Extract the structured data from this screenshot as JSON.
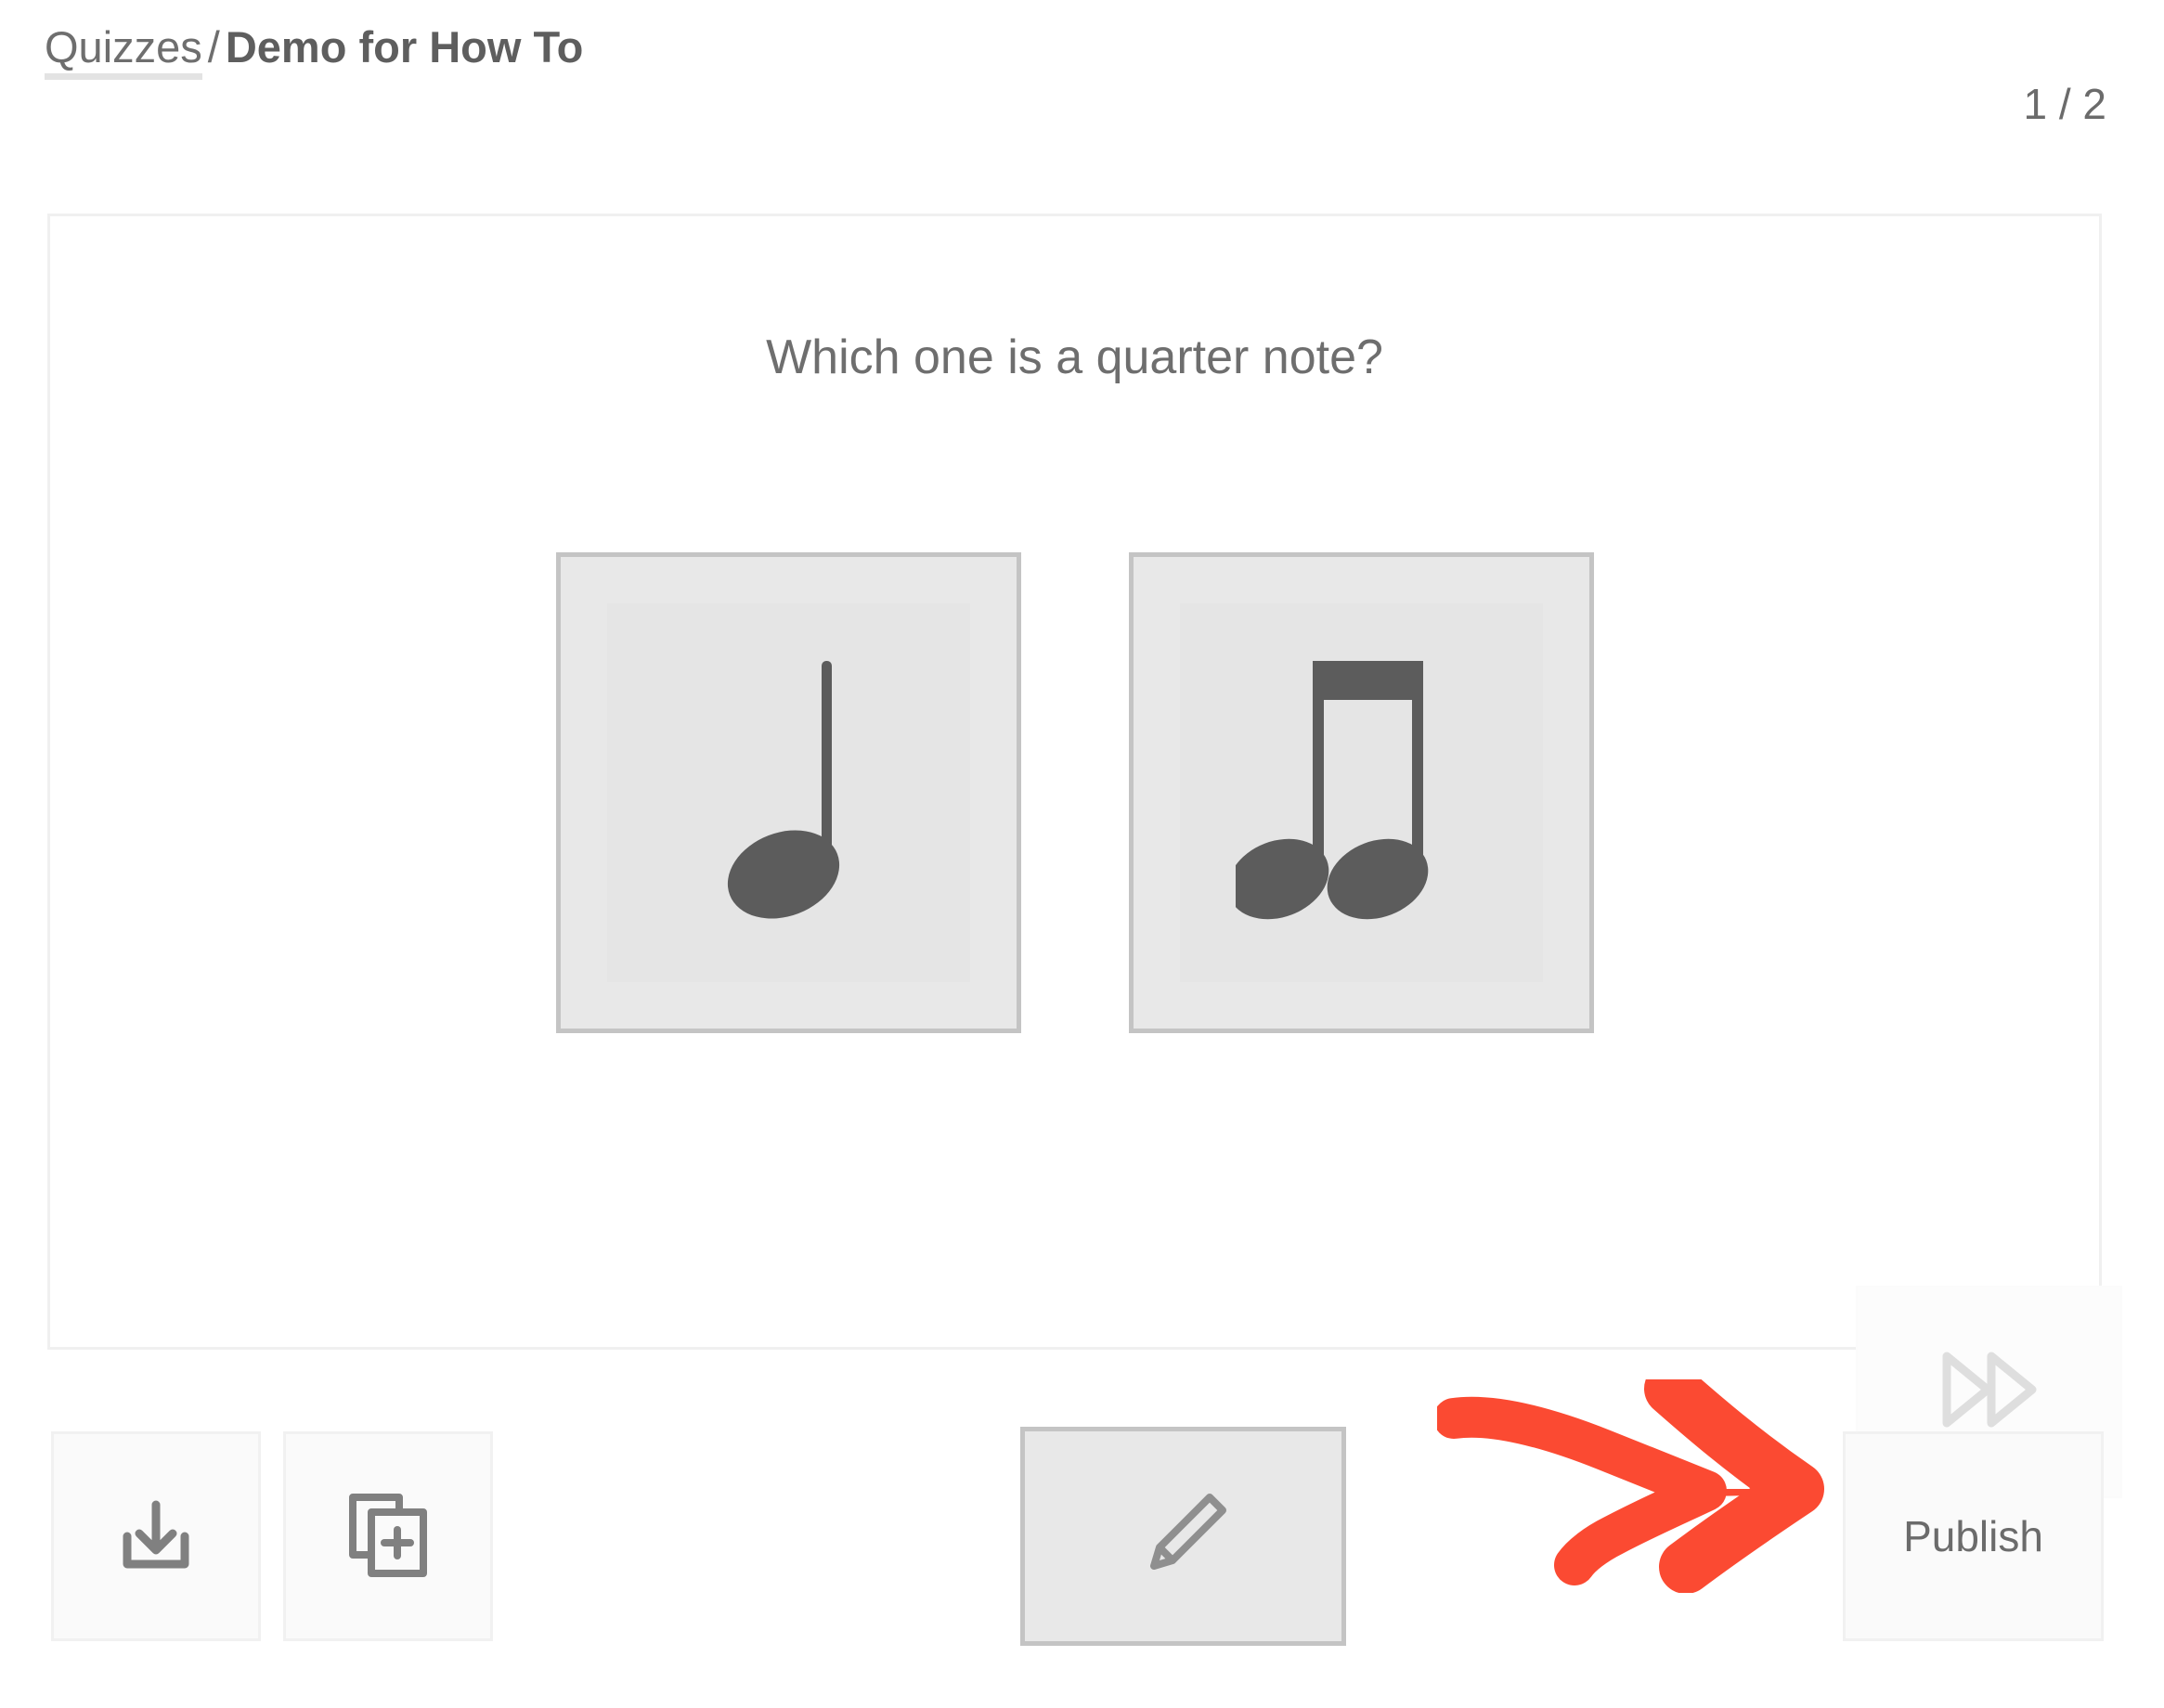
{
  "breadcrumb": {
    "parent_label": "Quizzes",
    "separator": "/",
    "current_label": "Demo for How To"
  },
  "page_counter": {
    "text": "1 / 2",
    "current": 1,
    "total": 2
  },
  "slide": {
    "question": "Which one is a quarter note?",
    "options": [
      {
        "index": 1,
        "icon": "quarter-note-icon",
        "alt": "quarter note"
      },
      {
        "index": 2,
        "icon": "eighth-note-pair-icon",
        "alt": "two beamed eighth notes"
      }
    ],
    "next_button": {
      "icon": "fast-forward-icon",
      "label": ""
    }
  },
  "toolbar": {
    "import_button": {
      "icon": "download-icon",
      "label": ""
    },
    "duplicate_button": {
      "icon": "duplicate-add-icon",
      "label": ""
    },
    "edit_button": {
      "icon": "pencil-icon",
      "label": ""
    },
    "publish_button": {
      "label": "Publish"
    }
  },
  "annotation": {
    "arrow": {
      "shape": "red-arrow-right",
      "points_to": "Publish",
      "color": "#fb4a32"
    }
  },
  "colors": {
    "text": "#6e6e6e",
    "card_border": "#f0f0f0",
    "option_border": "#c4c4c4",
    "option_fill": "#e8e8e8",
    "icon_gray": "#5c5c5c",
    "annotation_red": "#fb4a32"
  }
}
